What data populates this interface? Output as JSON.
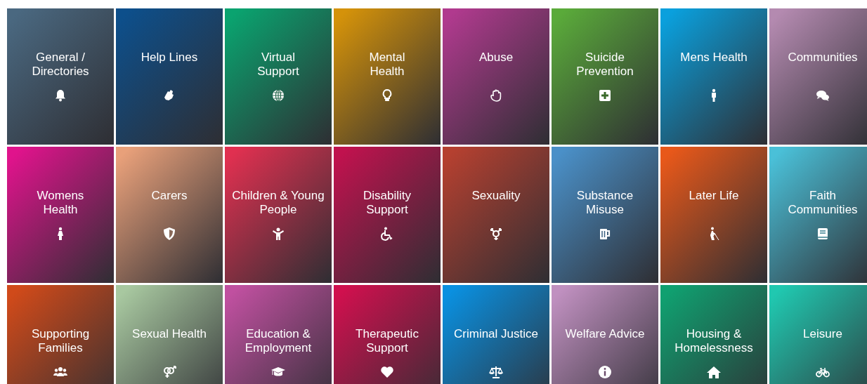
{
  "tiles": [
    {
      "label": "General /\nDirectories",
      "color": "#4a6880"
    },
    {
      "label": "Help Lines",
      "color": "#0d4f8b"
    },
    {
      "label": "Virtual\nSupport",
      "color": "#0aa36f"
    },
    {
      "label": "Mental\nHealth",
      "color": "#d4920a"
    },
    {
      "label": "Abuse",
      "color": "#b03a8e"
    },
    {
      "label": "Suicide\nPrevention",
      "color": "#5aaa3a"
    },
    {
      "label": "Mens Health",
      "color": "#0aa0dd"
    },
    {
      "label": "Communities",
      "color": "#b48ab0"
    },
    {
      "label": "Womens\nHealth",
      "color": "#e0138c"
    },
    {
      "label": "Carers",
      "color": "#e8a07a"
    },
    {
      "label": "Children & Young\nPeople",
      "color": "#e03050"
    },
    {
      "label": "Disability\nSupport",
      "color": "#c0124e"
    },
    {
      "label": "Sexuality",
      "color": "#b54030"
    },
    {
      "label": "Substance\nMisuse",
      "color": "#4a90c8"
    },
    {
      "label": "Later Life",
      "color": "#e8581a"
    },
    {
      "label": "Faith\nCommunities",
      "color": "#4ac0d8"
    },
    {
      "label": "Supporting\nFamilies",
      "color": "#d04a1a"
    },
    {
      "label": "Sexual Health",
      "color": "#a8c8a0"
    },
    {
      "label": "Education &\nEmployment",
      "color": "#c050a0"
    },
    {
      "label": "Therapeutic\nSupport",
      "color": "#d0104e"
    },
    {
      "label": "Criminal Justice",
      "color": "#0a90e0"
    },
    {
      "label": "Welfare Advice",
      "color": "#c090c0"
    },
    {
      "label": "Housing &\nHomelessness",
      "color": "#10a070"
    },
    {
      "label": "Leisure",
      "color": "#20c8b0"
    }
  ]
}
